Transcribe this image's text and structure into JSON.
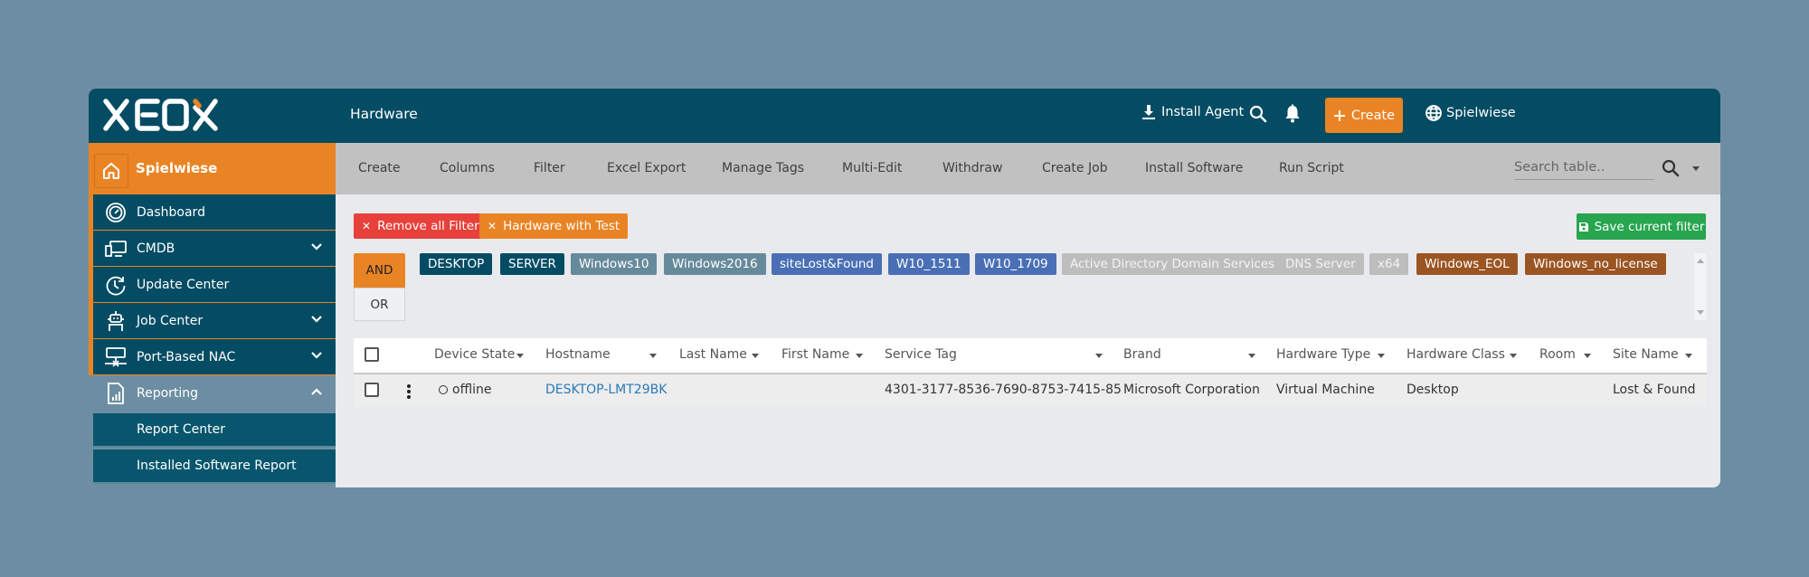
{
  "topbar": {
    "logo_text": "XEOX",
    "page_title": "Hardware",
    "install_agent_label": "Install Agent",
    "create_label": "Create",
    "tenant_label": "Spielwiese",
    "icons": [
      "download-icon",
      "search-icon",
      "bell-icon",
      "plus-icon",
      "globe-icon"
    ]
  },
  "sidebar": {
    "tenant": "Spielwiese",
    "items": [
      {
        "label": "Dashboard",
        "icon": "dashboard-gauge-icon",
        "expandable": false
      },
      {
        "label": "CMDB",
        "icon": "devices-icon",
        "expandable": true
      },
      {
        "label": "Update Center",
        "icon": "update-clock-icon",
        "expandable": false
      },
      {
        "label": "Job Center",
        "icon": "robot-icon",
        "expandable": true
      },
      {
        "label": "Port-Based NAC",
        "icon": "network-switch-icon",
        "expandable": true
      },
      {
        "label": "Reporting",
        "icon": "report-chart-icon",
        "expandable": true,
        "expanded": true
      }
    ],
    "sub_items": [
      "Report Center",
      "Installed Software Report"
    ]
  },
  "toolbar": {
    "actions": [
      "Create",
      "Columns",
      "Filter",
      "Excel Export",
      "Manage Tags",
      "Multi-Edit",
      "Withdraw",
      "Create Job",
      "Install Software",
      "Run Script"
    ],
    "search_placeholder": "Search table.."
  },
  "filters": {
    "remove_all_label": "Remove all Filter",
    "active_filter_label": "Hardware with Test",
    "save_label": "Save current filter",
    "logic": {
      "and_label": "AND",
      "or_label": "OR",
      "selected": "AND"
    },
    "tags": [
      {
        "label": "DESKTOP",
        "color": "#044c63"
      },
      {
        "label": "SERVER",
        "color": "#044c63"
      },
      {
        "label": "Windows10",
        "color": "#678a9b"
      },
      {
        "label": "Windows2016",
        "color": "#678a9b"
      },
      {
        "label": "siteLost&Found",
        "color": "#4a6fb5"
      },
      {
        "label": "W10_1511",
        "color": "#4a6fb5"
      },
      {
        "label": "W10_1709",
        "color": "#4a6fb5"
      },
      {
        "label": "Active Directory Domain Services",
        "color": "#bdbdbd"
      },
      {
        "label": "DNS Server",
        "color": "#bdbdbd"
      },
      {
        "label": "x64",
        "color": "#bdbdbd"
      },
      {
        "label": "Windows_EOL",
        "color": "#9b5523"
      },
      {
        "label": "Windows_no_license",
        "color": "#9b5523"
      }
    ]
  },
  "table": {
    "columns": [
      "Device State",
      "Hostname",
      "Last Name",
      "First Name",
      "Service Tag",
      "Brand",
      "Hardware Type",
      "Hardware Class",
      "Room",
      "Site Name"
    ],
    "rows": [
      {
        "device_state": "offline",
        "hostname": "DESKTOP-LMT29BK",
        "last_name": "",
        "first_name": "",
        "service_tag": "4301-3177-8536-7690-8753-7415-85",
        "brand": "Microsoft Corporation",
        "hardware_type": "Virtual Machine",
        "hardware_class": "Desktop",
        "room": "",
        "site_name": "Lost & Found"
      }
    ]
  },
  "colors": {
    "primary_dark": "#044c63",
    "accent_orange": "#e98424",
    "danger_red": "#e8403a",
    "success_green": "#27a54f",
    "background": "#6d8ea2"
  }
}
